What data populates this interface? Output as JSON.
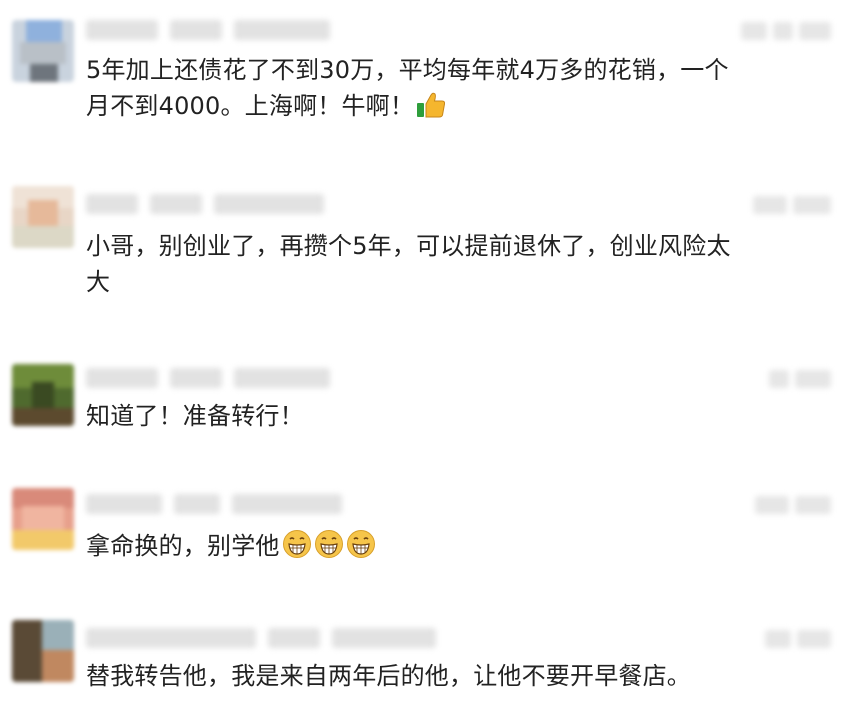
{
  "comments": [
    {
      "text_line1": "5年加上还债花了不到30万，平均每年就4万多的花销，一个",
      "text_line2": "月不到4000。上海啊！牛啊！",
      "emoji": [
        "thumbs-up-icon"
      ]
    },
    {
      "text_line1": "小哥，别创业了，再攒个5年，可以提前退休了，创业风险太",
      "text_line2": "大"
    },
    {
      "text_line1": "知道了！准备转行！"
    },
    {
      "text_line1": "拿命换的，别学他",
      "emoji": [
        "grinning-face-icon",
        "grinning-face-icon",
        "grinning-face-icon"
      ]
    },
    {
      "text_line1": "替我转告他，我是来自两年后的他，让他不要开早餐店。"
    }
  ],
  "colors": {
    "text": "#222222",
    "blur_placeholder": "#e2e2e2",
    "background": "#ffffff"
  }
}
